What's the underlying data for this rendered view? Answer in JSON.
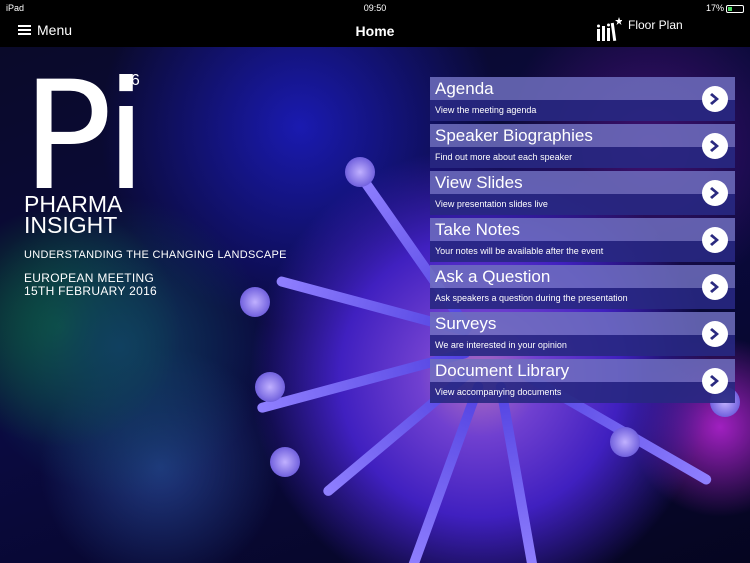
{
  "status": {
    "device": "iPad",
    "time": "09:50",
    "battery": "17%"
  },
  "nav": {
    "menu_label": "Menu",
    "title": "Home",
    "floor_plan_label": "Floor Plan"
  },
  "logo": {
    "letters": "Pi",
    "superscript": "16",
    "line1": "PHARMA",
    "line2": "INSIGHT"
  },
  "event": {
    "tagline": "UNDERSTANDING THE CHANGING LANDSCAPE",
    "meeting": "EUROPEAN MEETING",
    "date": "15TH FEBRUARY 2016"
  },
  "menu_items": [
    {
      "title": "Agenda",
      "subtitle": "View the meeting agenda"
    },
    {
      "title": "Speaker Biographies",
      "subtitle": "Find out more about each speaker"
    },
    {
      "title": "View Slides",
      "subtitle": "View presentation slides live"
    },
    {
      "title": "Take Notes",
      "subtitle": "Your notes will be available after the event"
    },
    {
      "title": "Ask a Question",
      "subtitle": "Ask speakers a question during the presentation"
    },
    {
      "title": "Surveys",
      "subtitle": "We are interested in your opinion"
    },
    {
      "title": "Document Library",
      "subtitle": "View accompanying documents"
    }
  ],
  "colors": {
    "arrow": "#2a2a80"
  }
}
